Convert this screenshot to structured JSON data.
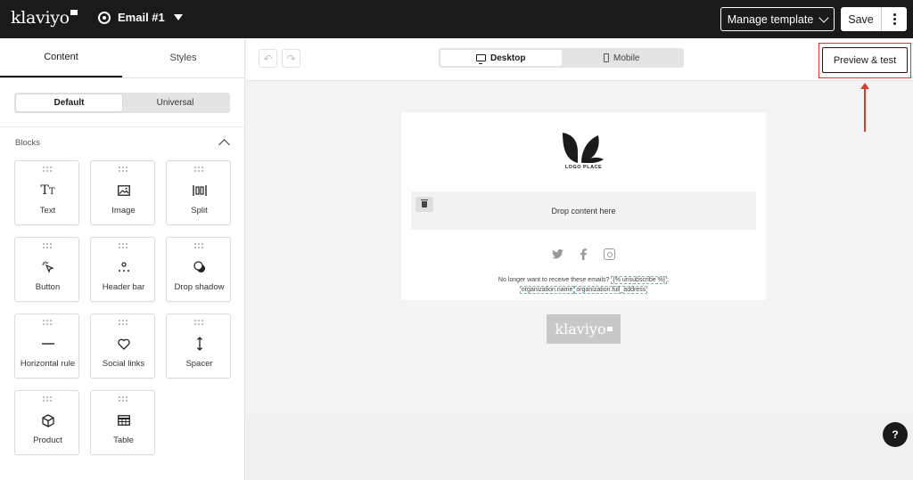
{
  "header": {
    "brand": "klaviyo",
    "email_name": "Email #1",
    "manage_label": "Manage template",
    "save_label": "Save"
  },
  "left_panel": {
    "tabs": [
      {
        "label": "Content",
        "active": true
      },
      {
        "label": "Styles",
        "active": false
      }
    ],
    "mode_toggle": [
      {
        "label": "Default",
        "active": true
      },
      {
        "label": "Universal",
        "active": false
      }
    ],
    "blocks_heading": "Blocks",
    "blocks": [
      {
        "label": "Text",
        "icon": "text-icon"
      },
      {
        "label": "Image",
        "icon": "image-icon"
      },
      {
        "label": "Split",
        "icon": "split-icon"
      },
      {
        "label": "Button",
        "icon": "button-cursor-icon"
      },
      {
        "label": "Header bar",
        "icon": "header-bar-icon"
      },
      {
        "label": "Drop shadow",
        "icon": "drop-shadow-icon"
      },
      {
        "label": "Horizontal rule",
        "icon": "horizontal-rule-icon"
      },
      {
        "label": "Social links",
        "icon": "heart-icon"
      },
      {
        "label": "Spacer",
        "icon": "spacer-icon"
      },
      {
        "label": "Product",
        "icon": "product-box-icon"
      },
      {
        "label": "Table",
        "icon": "table-icon"
      }
    ]
  },
  "canvas_toolbar": {
    "devices": [
      {
        "label": "Desktop",
        "icon": "monitor-icon",
        "active": true
      },
      {
        "label": "Mobile",
        "icon": "phone-icon",
        "active": false
      }
    ],
    "preview_label": "Preview & test"
  },
  "email": {
    "logo_text": "LOGO PLACE",
    "drop_text": "Drop content here",
    "unsubscribe_text": "No longer want to receive these emails?",
    "unsubscribe_tag": "{% unsubscribe %}",
    "org_name_tag": "organization.name",
    "org_address_tag": "organization.full_address",
    "footer_badge": "klaviyo"
  },
  "help_label": "?",
  "colors": {
    "topbar": "#1a1a1a",
    "highlight": "#e0392b",
    "canvas_bg": "#f4f4f4"
  }
}
